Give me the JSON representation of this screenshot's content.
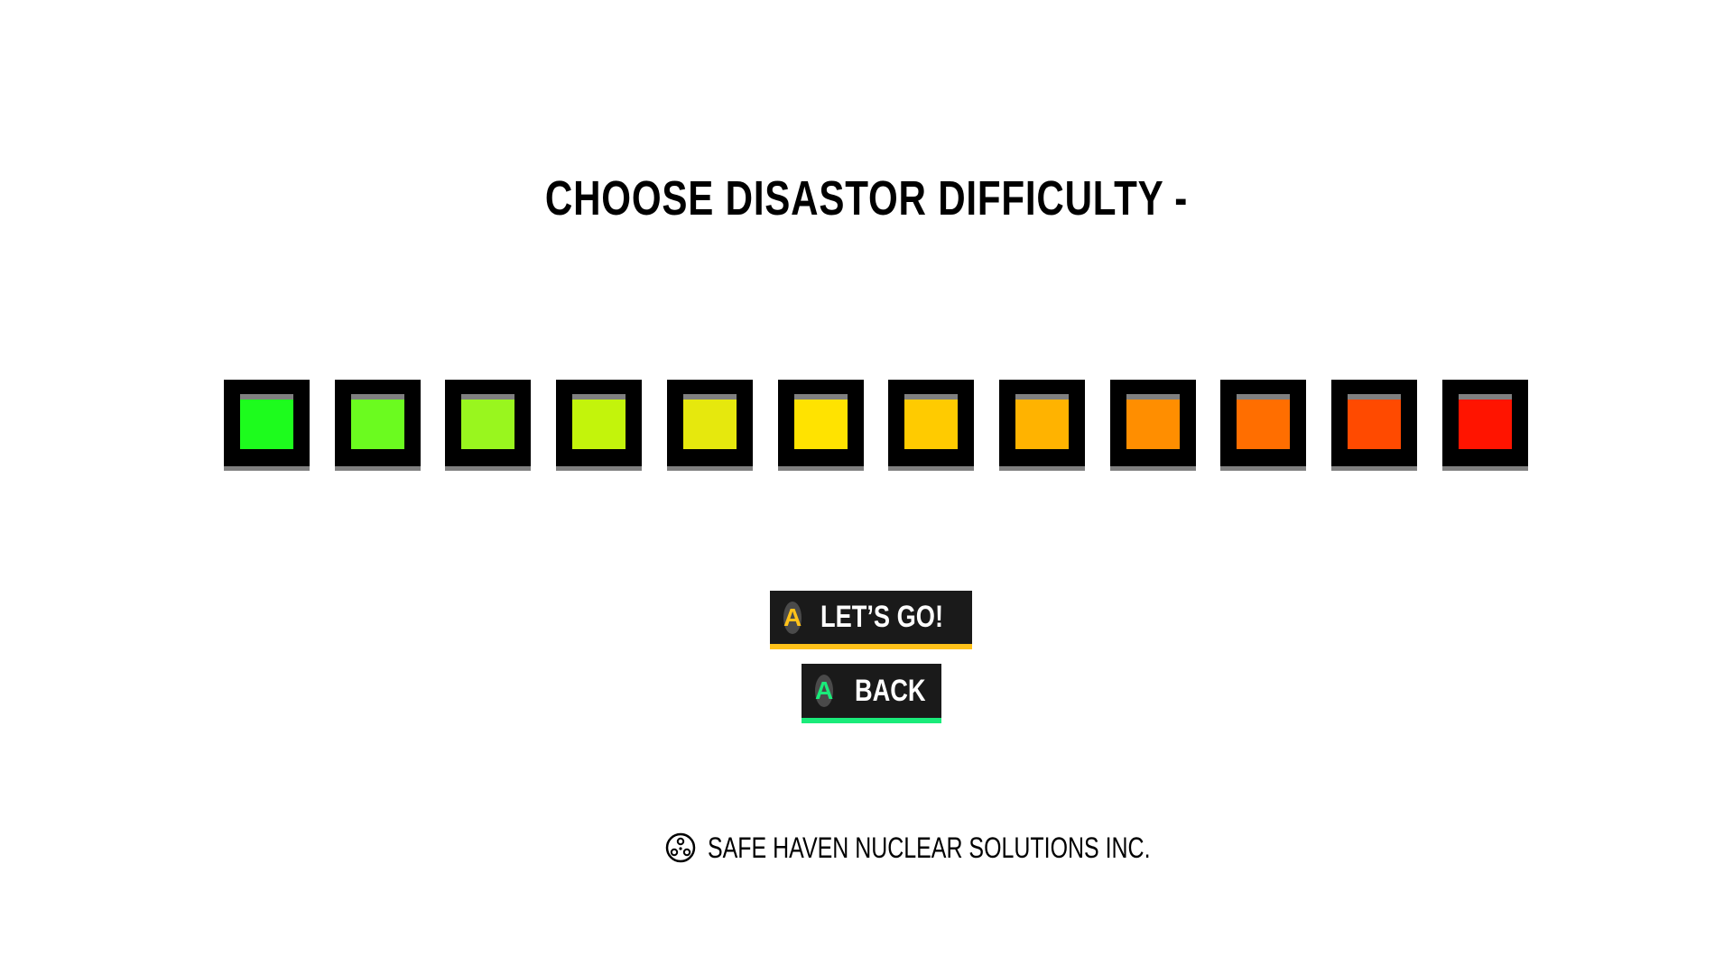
{
  "title": "CHOOSE DISASTOR DIFFICULTY -",
  "difficulty_levels": [
    {
      "color": "#1dfc1d"
    },
    {
      "color": "#6bfb1f"
    },
    {
      "color": "#99f61e"
    },
    {
      "color": "#c3f40b"
    },
    {
      "color": "#e6e80d"
    },
    {
      "color": "#ffe300"
    },
    {
      "color": "#ffcb00"
    },
    {
      "color": "#ffb300"
    },
    {
      "color": "#ff8e00"
    },
    {
      "color": "#ff6e00"
    },
    {
      "color": "#ff4a00"
    },
    {
      "color": "#ff1400"
    }
  ],
  "buttons": {
    "go": {
      "badge": "A",
      "label": "LET’S GO!",
      "accent": "#ffc21a"
    },
    "back": {
      "badge": "A",
      "label": "BACK",
      "accent": "#1aeb7a"
    }
  },
  "footer": {
    "icon": "radiation-logo-icon",
    "company": "SAFE HAVEN NUCLEAR SOLUTIONS INC."
  }
}
